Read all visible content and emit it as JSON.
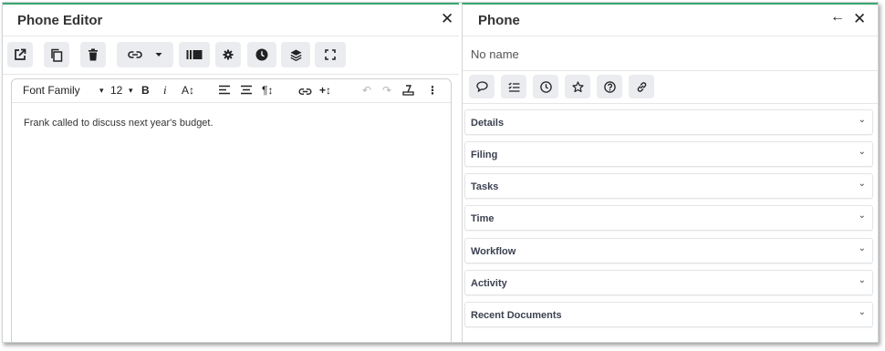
{
  "left_panel": {
    "title": "Phone Editor",
    "close_glyph": "✕",
    "toolbar": [
      {
        "name": "open-external-button",
        "icon": "open-external-icon"
      },
      {
        "name": "copy-button",
        "icon": "copy-icon"
      },
      {
        "name": "delete-button",
        "icon": "trash-icon"
      },
      {
        "name": "link-button",
        "icon": "link-icon"
      },
      {
        "name": "library-button",
        "icon": "library-icon"
      },
      {
        "name": "settings-button",
        "icon": "gear-icon"
      },
      {
        "name": "history-button",
        "icon": "clock-icon"
      },
      {
        "name": "layers-button",
        "icon": "layers-icon"
      },
      {
        "name": "fullscreen-button",
        "icon": "fullscreen-icon"
      }
    ],
    "editor": {
      "font_family_label": "Font Family",
      "font_size": "12",
      "bold": "B",
      "italic": "i",
      "font_size_tool": "A↕",
      "paragraph": "¶↕",
      "insert": "+↕",
      "more": "⋮",
      "content": "Frank called to discuss next year's budget."
    }
  },
  "right_panel": {
    "title": "Phone",
    "back_glyph": "←",
    "close_glyph": "✕",
    "name": "No name",
    "icon_buttons": [
      "comment-icon",
      "checklist-icon",
      "clock-icon",
      "star-icon",
      "help-icon",
      "link-icon"
    ],
    "sections": [
      "Details",
      "Filing",
      "Tasks",
      "Time",
      "Workflow",
      "Activity",
      "Recent Documents"
    ]
  },
  "colors": {
    "accent": "#3aa870",
    "button_bg": "#eaecef"
  }
}
